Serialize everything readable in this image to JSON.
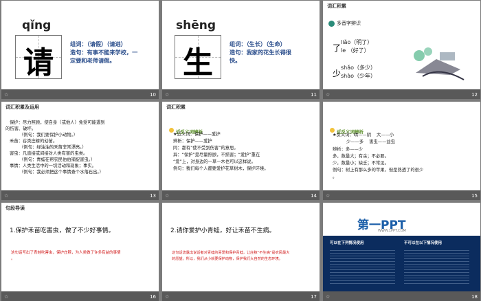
{
  "slides": {
    "s10": {
      "pinyin": "qǐng",
      "char": "请",
      "l1": "组词：（请假）（请进）",
      "l2": "造句：有事不能来学校，一",
      "l3": "定要和老师请假。",
      "num": "10"
    },
    "s11": {
      "pinyin": "shēng",
      "char": "生",
      "l1": "组词：（生长）（生命）",
      "l2": "造句：我家的花生长得很",
      "l3": "快。",
      "num": "11"
    },
    "s12": {
      "title": "词汇积累",
      "label": "多音字辨识",
      "a1": "liǎo（明了）",
      "a2": "le  （好了）",
      "achar": "了",
      "b1": "shǎo（多少）",
      "b2": "shào（少年）",
      "bchar": "少",
      "num": "12"
    },
    "s13": {
      "title": "词汇积累及运用",
      "lines": [
        "保护：尽力照顾，使自身（或他人）免受可能遇到",
        "的伤害、破坏。",
        "（例句：我们要保护小动物。）",
        "禾苗：谷类庄稼的幼苗。",
        "（例句：绿油油的禾苗非常漂亮。）",
        "害虫：凡直接或间接对人类有害的虫类。",
        "（例句：青蛙在帮农民伯伯捕捉害虫。）",
        "事情：人类生活中的一切活动和现象；事实。",
        "（例句：我必须把这个事情查个水落石出。）"
      ],
      "num": "13"
    },
    "s14": {
      "title": "词汇积累",
      "label": "近反义词辨析",
      "lines": [
        "★近义词：保护——爱护",
        "辨析：保护——爱护",
        "同：都有“使不受到伤害”的意思。",
        "异：“保护”是尽量照顾，不损害；“爱护”重在",
        "“爱”上，对身边的一草一木也可以这样说。",
        "例句：我们每个人都要爱护花草树木，保护环境。"
      ],
      "num": "14"
    },
    "s15": {
      "label": "近反义词辨析",
      "lines": [
        "★反义词：晴——阴    大——小",
        "          少——多    害虫——益虫",
        "辨析：多——少",
        "多，数量大；有余；不必要。",
        "少，数量小；缺乏；不常见。",
        "例句：树上有那么多的苹果，但是熟透了的很少",
        "。"
      ],
      "num": "15"
    },
    "s16": {
      "title": "句段导读",
      "main": "1.保护禾苗吃害虫，做了不少好事情。",
      "red1": "这句话写出了青蛙吃害虫，保护庄稼，为人类做了许多有益的事情",
      "red2": "。",
      "num": "16"
    },
    "s17": {
      "main": "2.请你爱护小青蛙，好让禾苗不生病。",
      "red1": "这句话流露出说话者对青蛙的喜爱和保护青蛙，让庄稼“不生病”是农民最大",
      "red2": "的愿望。所以，我们从小就要保护动物，保护我们大自然的生态环境。",
      "num": "17"
    },
    "s18": {
      "logo": "第一PPT",
      "url": "WWW.1PPT.COM",
      "h1": "可以在下列情况使用",
      "h2": "不可以在以下情况使用",
      "num": "18"
    }
  }
}
